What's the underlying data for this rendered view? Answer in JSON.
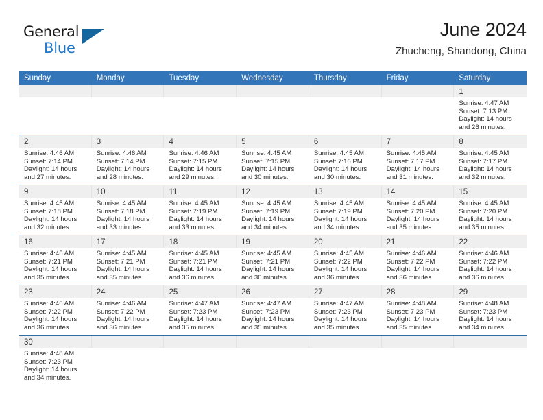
{
  "brand": {
    "name_part1": "General",
    "name_part2": "Blue",
    "triangle_icon": "triangle-logo-icon",
    "color_dark": "#1b1b1b",
    "color_blue": "#2076c6",
    "color_triangle": "#15659f"
  },
  "header": {
    "title": "June 2024",
    "subtitle": "Zhucheng, Shandong, China"
  },
  "theme": {
    "header_bar": "#3275b8",
    "row_divider": "#2e6da8",
    "day_band": "#efefef",
    "text": "#2a2a2a"
  },
  "weekdays": [
    {
      "label": "Sunday"
    },
    {
      "label": "Monday"
    },
    {
      "label": "Tuesday"
    },
    {
      "label": "Wednesday"
    },
    {
      "label": "Thursday"
    },
    {
      "label": "Friday"
    },
    {
      "label": "Saturday"
    }
  ],
  "weeks": [
    {
      "days": [
        {
          "num": "",
          "l1": "",
          "l2": "",
          "l3": "",
          "l4": ""
        },
        {
          "num": "",
          "l1": "",
          "l2": "",
          "l3": "",
          "l4": ""
        },
        {
          "num": "",
          "l1": "",
          "l2": "",
          "l3": "",
          "l4": ""
        },
        {
          "num": "",
          "l1": "",
          "l2": "",
          "l3": "",
          "l4": ""
        },
        {
          "num": "",
          "l1": "",
          "l2": "",
          "l3": "",
          "l4": ""
        },
        {
          "num": "",
          "l1": "",
          "l2": "",
          "l3": "",
          "l4": ""
        },
        {
          "num": "1",
          "l1": "Sunrise: 4:47 AM",
          "l2": "Sunset: 7:13 PM",
          "l3": "Daylight: 14 hours",
          "l4": "and 26 minutes."
        }
      ]
    },
    {
      "days": [
        {
          "num": "2",
          "l1": "Sunrise: 4:46 AM",
          "l2": "Sunset: 7:14 PM",
          "l3": "Daylight: 14 hours",
          "l4": "and 27 minutes."
        },
        {
          "num": "3",
          "l1": "Sunrise: 4:46 AM",
          "l2": "Sunset: 7:14 PM",
          "l3": "Daylight: 14 hours",
          "l4": "and 28 minutes."
        },
        {
          "num": "4",
          "l1": "Sunrise: 4:46 AM",
          "l2": "Sunset: 7:15 PM",
          "l3": "Daylight: 14 hours",
          "l4": "and 29 minutes."
        },
        {
          "num": "5",
          "l1": "Sunrise: 4:45 AM",
          "l2": "Sunset: 7:15 PM",
          "l3": "Daylight: 14 hours",
          "l4": "and 30 minutes."
        },
        {
          "num": "6",
          "l1": "Sunrise: 4:45 AM",
          "l2": "Sunset: 7:16 PM",
          "l3": "Daylight: 14 hours",
          "l4": "and 30 minutes."
        },
        {
          "num": "7",
          "l1": "Sunrise: 4:45 AM",
          "l2": "Sunset: 7:17 PM",
          "l3": "Daylight: 14 hours",
          "l4": "and 31 minutes."
        },
        {
          "num": "8",
          "l1": "Sunrise: 4:45 AM",
          "l2": "Sunset: 7:17 PM",
          "l3": "Daylight: 14 hours",
          "l4": "and 32 minutes."
        }
      ]
    },
    {
      "days": [
        {
          "num": "9",
          "l1": "Sunrise: 4:45 AM",
          "l2": "Sunset: 7:18 PM",
          "l3": "Daylight: 14 hours",
          "l4": "and 32 minutes."
        },
        {
          "num": "10",
          "l1": "Sunrise: 4:45 AM",
          "l2": "Sunset: 7:18 PM",
          "l3": "Daylight: 14 hours",
          "l4": "and 33 minutes."
        },
        {
          "num": "11",
          "l1": "Sunrise: 4:45 AM",
          "l2": "Sunset: 7:19 PM",
          "l3": "Daylight: 14 hours",
          "l4": "and 33 minutes."
        },
        {
          "num": "12",
          "l1": "Sunrise: 4:45 AM",
          "l2": "Sunset: 7:19 PM",
          "l3": "Daylight: 14 hours",
          "l4": "and 34 minutes."
        },
        {
          "num": "13",
          "l1": "Sunrise: 4:45 AM",
          "l2": "Sunset: 7:19 PM",
          "l3": "Daylight: 14 hours",
          "l4": "and 34 minutes."
        },
        {
          "num": "14",
          "l1": "Sunrise: 4:45 AM",
          "l2": "Sunset: 7:20 PM",
          "l3": "Daylight: 14 hours",
          "l4": "and 35 minutes."
        },
        {
          "num": "15",
          "l1": "Sunrise: 4:45 AM",
          "l2": "Sunset: 7:20 PM",
          "l3": "Daylight: 14 hours",
          "l4": "and 35 minutes."
        }
      ]
    },
    {
      "days": [
        {
          "num": "16",
          "l1": "Sunrise: 4:45 AM",
          "l2": "Sunset: 7:21 PM",
          "l3": "Daylight: 14 hours",
          "l4": "and 35 minutes."
        },
        {
          "num": "17",
          "l1": "Sunrise: 4:45 AM",
          "l2": "Sunset: 7:21 PM",
          "l3": "Daylight: 14 hours",
          "l4": "and 35 minutes."
        },
        {
          "num": "18",
          "l1": "Sunrise: 4:45 AM",
          "l2": "Sunset: 7:21 PM",
          "l3": "Daylight: 14 hours",
          "l4": "and 36 minutes."
        },
        {
          "num": "19",
          "l1": "Sunrise: 4:45 AM",
          "l2": "Sunset: 7:21 PM",
          "l3": "Daylight: 14 hours",
          "l4": "and 36 minutes."
        },
        {
          "num": "20",
          "l1": "Sunrise: 4:45 AM",
          "l2": "Sunset: 7:22 PM",
          "l3": "Daylight: 14 hours",
          "l4": "and 36 minutes."
        },
        {
          "num": "21",
          "l1": "Sunrise: 4:46 AM",
          "l2": "Sunset: 7:22 PM",
          "l3": "Daylight: 14 hours",
          "l4": "and 36 minutes."
        },
        {
          "num": "22",
          "l1": "Sunrise: 4:46 AM",
          "l2": "Sunset: 7:22 PM",
          "l3": "Daylight: 14 hours",
          "l4": "and 36 minutes."
        }
      ]
    },
    {
      "days": [
        {
          "num": "23",
          "l1": "Sunrise: 4:46 AM",
          "l2": "Sunset: 7:22 PM",
          "l3": "Daylight: 14 hours",
          "l4": "and 36 minutes."
        },
        {
          "num": "24",
          "l1": "Sunrise: 4:46 AM",
          "l2": "Sunset: 7:22 PM",
          "l3": "Daylight: 14 hours",
          "l4": "and 36 minutes."
        },
        {
          "num": "25",
          "l1": "Sunrise: 4:47 AM",
          "l2": "Sunset: 7:23 PM",
          "l3": "Daylight: 14 hours",
          "l4": "and 35 minutes."
        },
        {
          "num": "26",
          "l1": "Sunrise: 4:47 AM",
          "l2": "Sunset: 7:23 PM",
          "l3": "Daylight: 14 hours",
          "l4": "and 35 minutes."
        },
        {
          "num": "27",
          "l1": "Sunrise: 4:47 AM",
          "l2": "Sunset: 7:23 PM",
          "l3": "Daylight: 14 hours",
          "l4": "and 35 minutes."
        },
        {
          "num": "28",
          "l1": "Sunrise: 4:48 AM",
          "l2": "Sunset: 7:23 PM",
          "l3": "Daylight: 14 hours",
          "l4": "and 35 minutes."
        },
        {
          "num": "29",
          "l1": "Sunrise: 4:48 AM",
          "l2": "Sunset: 7:23 PM",
          "l3": "Daylight: 14 hours",
          "l4": "and 34 minutes."
        }
      ]
    },
    {
      "days": [
        {
          "num": "30",
          "l1": "Sunrise: 4:48 AM",
          "l2": "Sunset: 7:23 PM",
          "l3": "Daylight: 14 hours",
          "l4": "and 34 minutes."
        },
        {
          "num": "",
          "l1": "",
          "l2": "",
          "l3": "",
          "l4": ""
        },
        {
          "num": "",
          "l1": "",
          "l2": "",
          "l3": "",
          "l4": ""
        },
        {
          "num": "",
          "l1": "",
          "l2": "",
          "l3": "",
          "l4": ""
        },
        {
          "num": "",
          "l1": "",
          "l2": "",
          "l3": "",
          "l4": ""
        },
        {
          "num": "",
          "l1": "",
          "l2": "",
          "l3": "",
          "l4": ""
        },
        {
          "num": "",
          "l1": "",
          "l2": "",
          "l3": "",
          "l4": ""
        }
      ]
    }
  ]
}
